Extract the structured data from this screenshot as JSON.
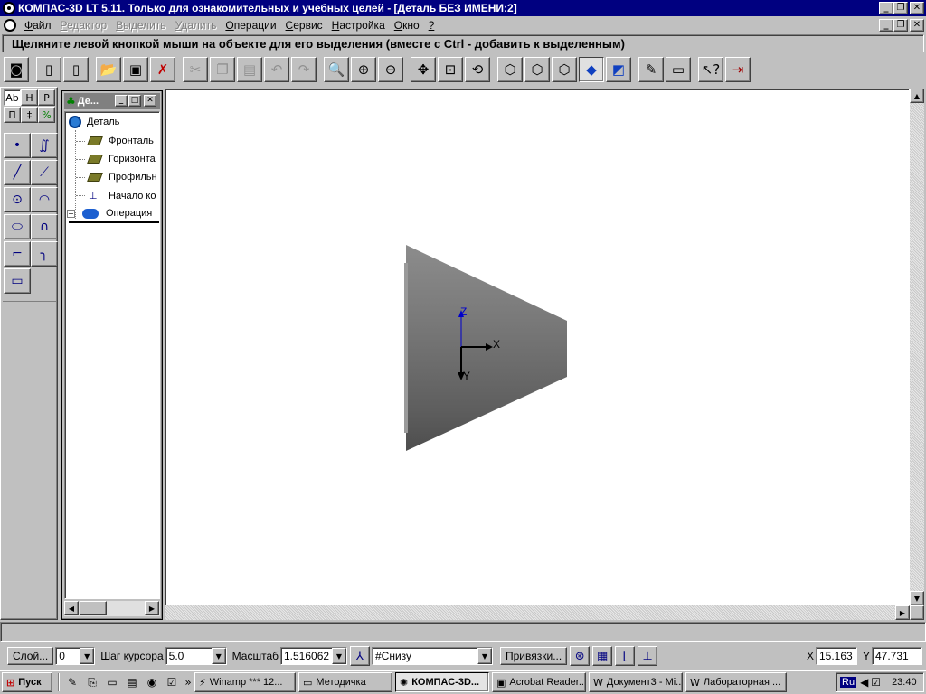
{
  "window": {
    "title": "КОМПАС-3D LT 5.11. Только для ознакомительных и учебных целей - [Деталь БЕЗ ИМЕНИ:2]",
    "controls": {
      "minimize": "_",
      "maximize": "❐",
      "close": "✕"
    }
  },
  "menu": {
    "items": [
      {
        "label": "Файл",
        "mnemonic": "Ф",
        "rest": "айл",
        "enabled": true
      },
      {
        "label": "Редактор",
        "mnemonic": "Р",
        "rest": "едактор",
        "enabled": false
      },
      {
        "label": "Выделить",
        "mnemonic": "В",
        "rest": "ыделить",
        "enabled": false
      },
      {
        "label": "Удалить",
        "mnemonic": "У",
        "rest": "далить",
        "enabled": false
      },
      {
        "label": "Операции",
        "mnemonic": "О",
        "rest": "перации",
        "enabled": true
      },
      {
        "label": "Сервис",
        "mnemonic": "С",
        "rest": "ервис",
        "enabled": true
      },
      {
        "label": "Настройка",
        "mnemonic": "Н",
        "rest": "астройка",
        "enabled": true
      },
      {
        "label": "Окно",
        "mnemonic": "О",
        "rest": "кно",
        "enabled": true
      },
      {
        "label": "?",
        "mnemonic": "?",
        "rest": "",
        "enabled": true
      }
    ]
  },
  "prompt": "Щелкните левой кнопкой мыши на объекте для его выделения (вместе с Ctrl - добавить к выделенным)",
  "toolbar": {
    "buttons": [
      {
        "icon": "camera-icon",
        "glyph": "◙"
      },
      {
        "icon": "new-sheet-icon",
        "glyph": "▯"
      },
      {
        "icon": "new-document-icon",
        "glyph": "▯"
      },
      {
        "icon": "open-folder-icon",
        "glyph": "📂"
      },
      {
        "icon": "save-icon",
        "glyph": "▣"
      },
      {
        "icon": "delete-icon",
        "glyph": "✗"
      },
      {
        "icon": "cut-icon",
        "glyph": "✂",
        "disabled": true
      },
      {
        "icon": "copy-icon",
        "glyph": "❐",
        "disabled": true
      },
      {
        "icon": "paste-icon",
        "glyph": "▤",
        "disabled": true
      },
      {
        "icon": "undo-icon",
        "glyph": "↶",
        "disabled": true
      },
      {
        "icon": "redo-icon",
        "glyph": "↷",
        "disabled": true
      },
      {
        "icon": "zoom-icon",
        "glyph": "🔍"
      },
      {
        "icon": "zoom-in-icon",
        "glyph": "⊕"
      },
      {
        "icon": "zoom-out-icon",
        "glyph": "⊖"
      },
      {
        "icon": "pan-icon",
        "glyph": "✥"
      },
      {
        "icon": "zoom-fit-icon",
        "glyph": "⊡"
      },
      {
        "icon": "rotate-icon",
        "glyph": "⟲"
      },
      {
        "icon": "wireframe-icon",
        "glyph": "⬡"
      },
      {
        "icon": "hidden-lines-icon",
        "glyph": "⬡"
      },
      {
        "icon": "hidden-thin-icon",
        "glyph": "⬡"
      },
      {
        "icon": "shaded-icon",
        "glyph": "◆",
        "active": true
      },
      {
        "icon": "perspective-icon",
        "glyph": "◩"
      },
      {
        "icon": "sketch-icon",
        "glyph": "✎"
      },
      {
        "icon": "properties-icon",
        "glyph": "▭"
      },
      {
        "icon": "help-pointer-icon",
        "glyph": "↖?"
      },
      {
        "icon": "exit-icon",
        "glyph": "⇥"
      }
    ]
  },
  "palette": {
    "tabs": [
      "Ab",
      "H",
      "P",
      "П",
      "‡",
      "%"
    ],
    "tools": [
      {
        "name": "point-icon",
        "glyph": "•"
      },
      {
        "name": "spline-icon",
        "glyph": "∬"
      },
      {
        "name": "line-icon",
        "glyph": "╱"
      },
      {
        "name": "segment-icon",
        "glyph": "⟋"
      },
      {
        "name": "circle-icon",
        "glyph": "⊙"
      },
      {
        "name": "arc-icon",
        "glyph": "◠"
      },
      {
        "name": "ellipse-icon",
        "glyph": "⬭"
      },
      {
        "name": "bezier-icon",
        "glyph": "∩"
      },
      {
        "name": "chamfer-icon",
        "glyph": "⌐"
      },
      {
        "name": "fillet-icon",
        "glyph": "╮"
      },
      {
        "name": "rectangle-icon",
        "glyph": "▭"
      }
    ]
  },
  "tree": {
    "title": "Де...",
    "root": "Деталь",
    "items": [
      {
        "label": "Фронталь"
      },
      {
        "label": "Горизонта"
      },
      {
        "label": "Профильн"
      },
      {
        "label": "Начало ко"
      },
      {
        "label": "Операция"
      }
    ]
  },
  "axes": {
    "z": "Z",
    "x": "X",
    "y": "Y"
  },
  "status": {
    "layer_button": "Слой...",
    "layer_value": "0",
    "cursor_step_label": "Шаг курсора",
    "cursor_step_value": "5.0",
    "scale_label": "Масштаб",
    "scale_value": "1.516062",
    "view_value": "#Снизу",
    "snaps_button": "Привязки...",
    "x_label": "X",
    "x_value": "15.163",
    "y_label": "Y",
    "y_value": "47.731"
  },
  "taskbar": {
    "start": "Пуск",
    "tasks": [
      {
        "label": "Winamp *** 12...",
        "icon": "winamp-icon",
        "glyph": "⚡"
      },
      {
        "label": "Методичка",
        "icon": "folder-icon",
        "glyph": "▭"
      },
      {
        "label": "КОМПАС-3D...",
        "icon": "kompas-icon",
        "glyph": "✺",
        "active": true
      },
      {
        "label": "Acrobat Reader...",
        "icon": "acrobat-icon",
        "glyph": "▣"
      },
      {
        "label": "Документ3 - Mi...",
        "icon": "word-icon",
        "glyph": "W"
      },
      {
        "label": "Лабораторная ...",
        "icon": "word-icon",
        "glyph": "W"
      }
    ],
    "language": "Ru",
    "clock": "23:40"
  },
  "colors": {
    "titlebar": "#000080",
    "face": "#c0c0c0",
    "canvas": "#ffffff",
    "axis_z": "#0000cc",
    "axis_xy": "#000000"
  }
}
